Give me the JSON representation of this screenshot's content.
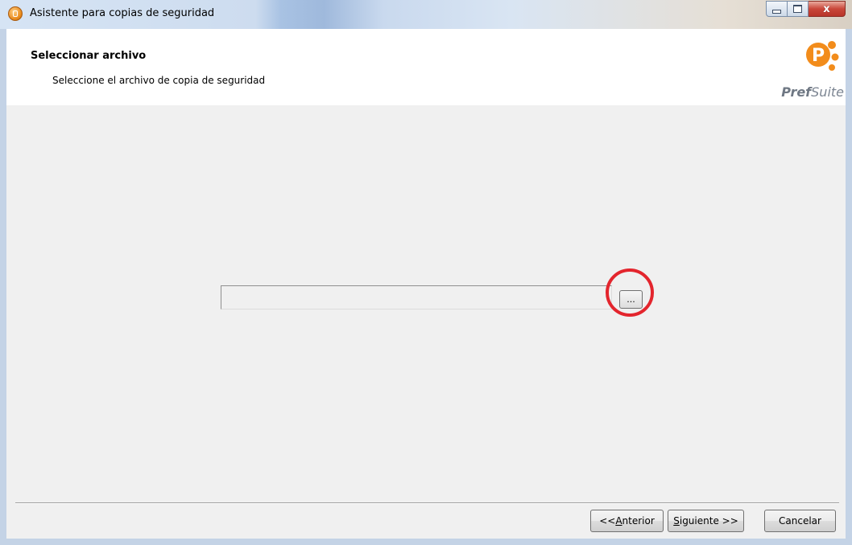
{
  "window": {
    "title": "Asistente para copias de seguridad",
    "icon": "app-backup-icon",
    "controls": {
      "minimize": "minimize-icon",
      "maximize": "maximize-icon",
      "close": "x"
    }
  },
  "header": {
    "title": "Seleccionar archivo",
    "subtitle": "Seleccione el archivo de copia de seguridad",
    "logo": {
      "text_bold": "Pref",
      "text_regular": "Suite",
      "mark": "P"
    }
  },
  "file_selector": {
    "path_value": "",
    "browse_label": "..."
  },
  "buttons": {
    "previous": {
      "prefix": "<< ",
      "hotkey": "A",
      "rest": "nterior"
    },
    "next": {
      "hotkey": "S",
      "rest": "iguiente >>"
    },
    "cancel": "Cancelar"
  },
  "colors": {
    "accent_orange": "#f28c1b",
    "highlight_red": "#e3252d",
    "logo_gray": "#7b8491"
  }
}
